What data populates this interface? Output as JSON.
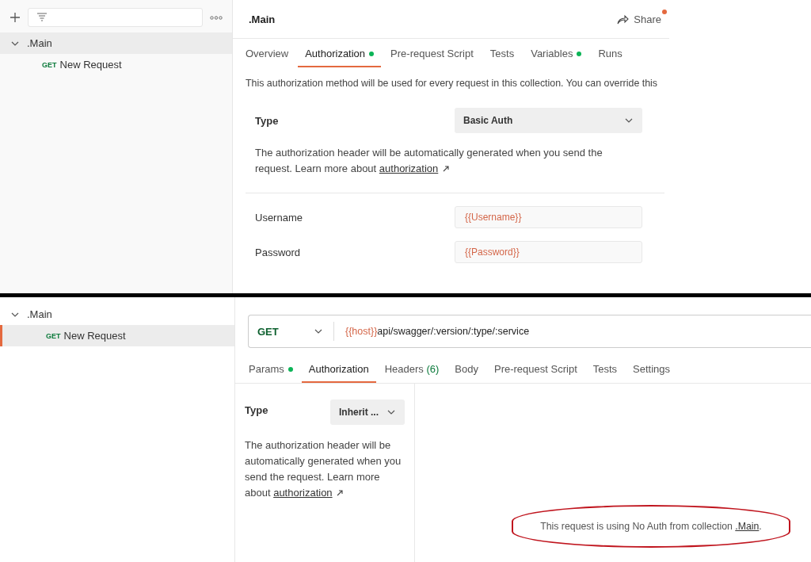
{
  "top_panel": {
    "sidebar": {
      "tree": [
        {
          "label": ".Main",
          "expanded": true,
          "selected": true,
          "children": [
            {
              "method": "GET",
              "label": "New Request",
              "selected": false
            }
          ]
        }
      ]
    },
    "header": {
      "title": ".Main",
      "share": "Share",
      "share_notification": true
    },
    "tabs": [
      {
        "label": "Overview",
        "selected": false,
        "dot": false
      },
      {
        "label": "Authorization",
        "selected": true,
        "dot": true
      },
      {
        "label": "Pre-request Script",
        "selected": false,
        "dot": false
      },
      {
        "label": "Tests",
        "selected": false,
        "dot": false
      },
      {
        "label": "Variables",
        "selected": false,
        "dot": true
      },
      {
        "label": "Runs",
        "selected": false,
        "dot": false
      }
    ],
    "description": "This authorization method will be used for every request in this collection. You can override this",
    "type": {
      "label": "Type",
      "value": "Basic Auth"
    },
    "help": {
      "text": "The authorization header will be automatically generated when you send the request. Learn more about",
      "link": "authorization"
    },
    "fields": [
      {
        "label": "Username",
        "value": "{{Username}}"
      },
      {
        "label": "Password",
        "value": "{{Password}}"
      }
    ]
  },
  "bottom_panel": {
    "sidebar": {
      "tree": [
        {
          "label": ".Main",
          "expanded": true,
          "selected": false,
          "children": [
            {
              "method": "GET",
              "label": "New Request",
              "selected": true
            }
          ]
        }
      ]
    },
    "request": {
      "method": "GET",
      "url_variable": "{{host}}",
      "url_path": "api/swagger/:version/:type/:service"
    },
    "tabs": [
      {
        "label": "Params",
        "selected": false,
        "dot": true
      },
      {
        "label": "Authorization",
        "selected": true,
        "dot": false
      },
      {
        "label": "Headers",
        "selected": false,
        "dot": false,
        "count": "(6)"
      },
      {
        "label": "Body",
        "selected": false,
        "dot": false
      },
      {
        "label": "Pre-request Script",
        "selected": false,
        "dot": false
      },
      {
        "label": "Tests",
        "selected": false,
        "dot": false
      },
      {
        "label": "Settings",
        "selected": false,
        "dot": false
      }
    ],
    "type": {
      "label": "Type",
      "value": "Inherit ..."
    },
    "help": {
      "text": "The authorization header will be automatically generated when you send the request. Learn more about",
      "link": "authorization"
    },
    "notice": {
      "text": "This request is using No Auth from collection",
      "link": ".Main",
      "end": ".",
      "highlighted": true
    }
  }
}
